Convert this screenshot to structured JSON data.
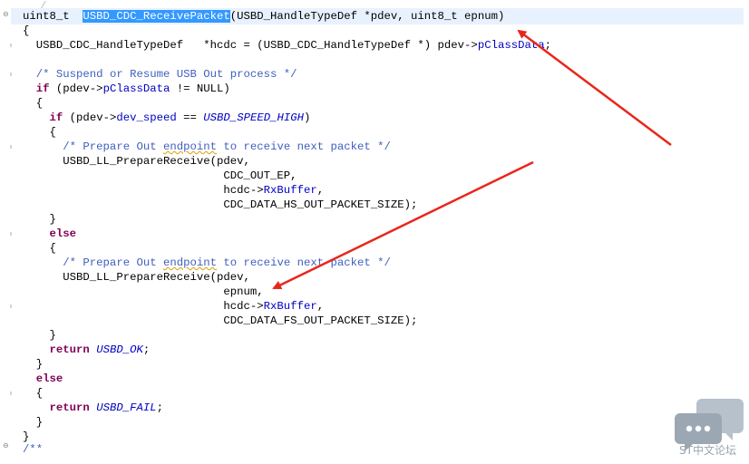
{
  "top_fragment": "/",
  "fold_minus": "⊖",
  "code": {
    "sig": {
      "ret": "uint8_t  ",
      "fn": "USBD_CDC_ReceivePacket",
      "params": "(USBD_HandleTypeDef *pdev, uint8_t epnum)"
    },
    "brace_open": "{",
    "decl": {
      "type": "USBD_CDC_HandleTypeDef",
      "mid": "   *hcdc = (USBD_CDC_HandleTypeDef *) pdev->",
      "field": "pClassData",
      "end": ";"
    },
    "comment_suspend": "/* Suspend or Resume USB Out process */",
    "if1": {
      "kw": "if",
      "a": " (pdev->",
      "field": "pClassData",
      "b": " != NULL)"
    },
    "brace_open_2": "{",
    "if2": {
      "kw": "if",
      "a": " (pdev->",
      "field": "dev_speed",
      "b": " == ",
      "macro": "USBD_SPEED_HIGH",
      "c": ")"
    },
    "brace_open_3": "{",
    "comment_prepare_1": {
      "a": "/* Prepare Out ",
      "squig": "endpoint",
      "b": " to receive next packet */"
    },
    "call_1": "USBD_LL_PrepareReceive(pdev,",
    "arg_ep": "CDC_OUT_EP,",
    "rx_1": {
      "a": "hcdc->",
      "field": "RxBuffer",
      "b": ","
    },
    "arg_hs": "CDC_DATA_HS_OUT_PACKET_SIZE);",
    "brace_close_3": "}",
    "else_1": "else",
    "brace_open_4": "{",
    "comment_prepare_2": {
      "a": "/* Prepare Out ",
      "squig": "endpoint",
      "b": " to receive next packet */"
    },
    "call_2": "USBD_LL_PrepareReceive(pdev,",
    "arg_epnum": "epnum,",
    "rx_2": {
      "a": "hcdc->",
      "field": "RxBuffer",
      "b": ","
    },
    "arg_fs": "CDC_DATA_FS_OUT_PACKET_SIZE);",
    "brace_close_4": "}",
    "return_ok": {
      "kw": "return",
      "sp": " ",
      "macro": "USBD_OK",
      "end": ";"
    },
    "brace_close_2": "}",
    "else_2": "else",
    "brace_open_5": "{",
    "return_fail": {
      "kw": "return",
      "sp": " ",
      "macro": "USBD_FAIL",
      "end": ";"
    },
    "brace_close_5": "}",
    "brace_close_1": "}",
    "doc_start": "/**"
  },
  "watermark": {
    "text": "ST中文论坛",
    "icon": "chat-bubbles-icon"
  },
  "colors": {
    "keyword": "#7f0055",
    "comment": "#3f5fbf",
    "field": "#0000c0",
    "selection": "#3399ff",
    "current_line": "#e8f2fe",
    "arrow": "#e8261c"
  }
}
